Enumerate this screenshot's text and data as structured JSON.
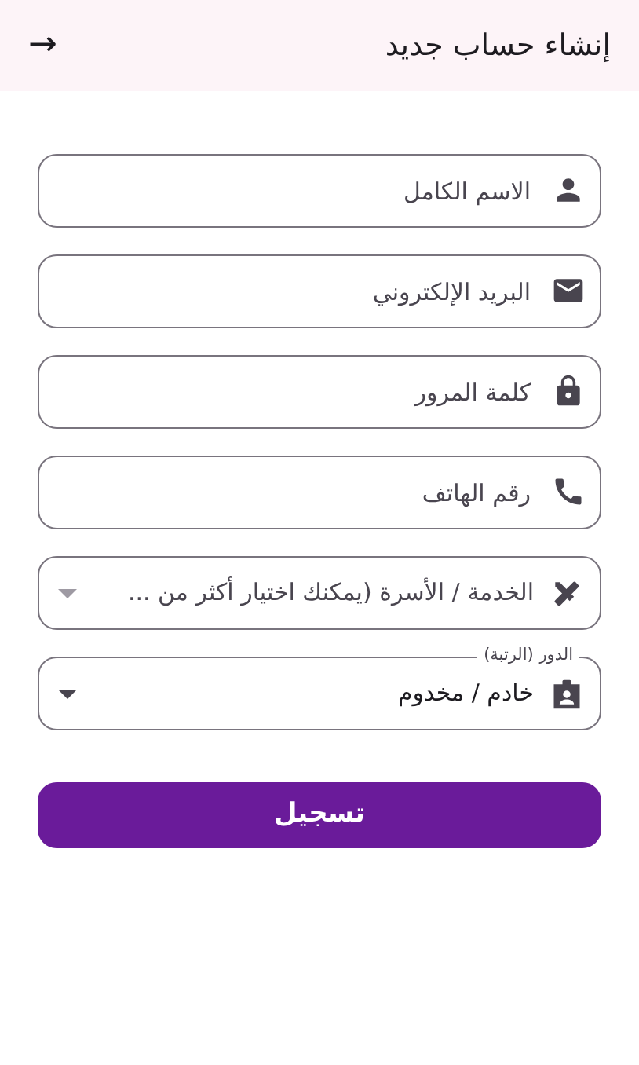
{
  "app_bar": {
    "title": "إنشاء حساب جديد",
    "back": "→"
  },
  "fields": [
    {
      "kind": "text",
      "placeholder": "الاسم الكامل"
    },
    {
      "kind": "text",
      "placeholder": "البريد الإلكتروني"
    },
    {
      "kind": "text",
      "placeholder": "كلمة المرور"
    },
    {
      "kind": "text",
      "placeholder": "رقم الهاتف"
    },
    {
      "kind": "select",
      "placeholder": "الخدمة / الأسرة (يمكنك اختيار أكثر من ..."
    },
    {
      "kind": "select",
      "label": "الدور (الرتبة)",
      "value": "خادم / مخدوم"
    }
  ],
  "submit": "تسجيل"
}
